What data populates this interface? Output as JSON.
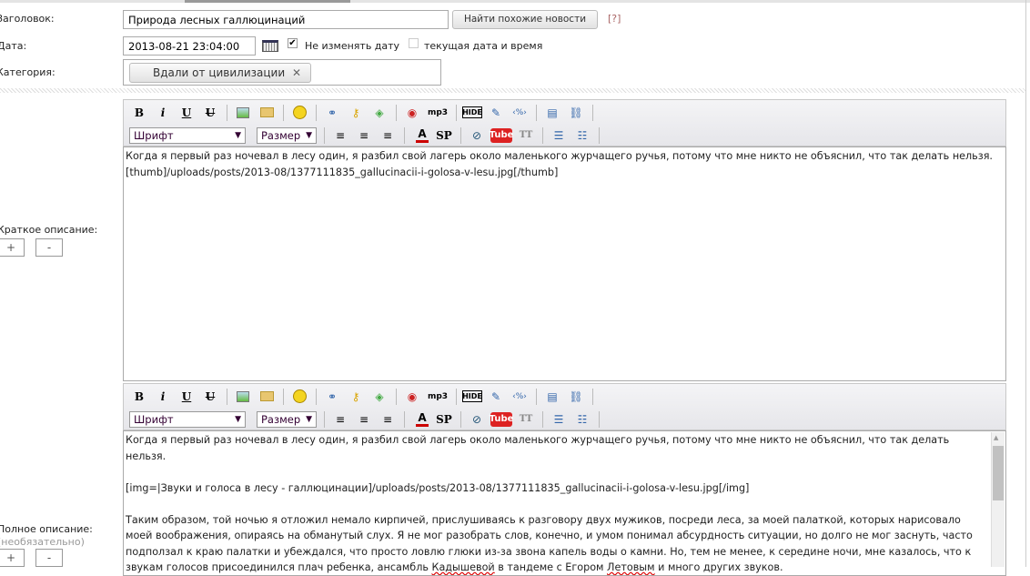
{
  "form": {
    "title_label": "Заголовок:",
    "title_value": "Природа лесных галлюцинаций",
    "find_similar_button": "Найти похожие новости",
    "help_link": "[?]",
    "date_label": "Дата:",
    "date_value": "2013-08-21 23:04:00",
    "keep_date_label": "Не изменять дату",
    "keep_date_checked": true,
    "current_date_label": "текущая дата и время",
    "current_date_checked": false,
    "category_label": "Категория:",
    "category_tag": "Вдали от цивилизации",
    "category_remove": "✕"
  },
  "toolbar": {
    "bold": "B",
    "italic": "i",
    "underline": "U",
    "strike": "U",
    "mp3": "mp3",
    "hide": "HIDE",
    "color": "A",
    "sp": "SP",
    "youtube": "Tube",
    "tt": "TT",
    "font_select": "Шрифт",
    "size_select": "Размер"
  },
  "short": {
    "label": "Краткое описание:",
    "plus": "+",
    "minus": "-",
    "text": "Когда я первый раз ночевал в лесу один, я разбил свой лагерь около маленького журчащего ручья, потому что мне никто не объяснил, что так делать нельзя.[thumb]/uploads/posts/2013-08/1377111835_gallucinacii-i-golosa-v-lesu.jpg[/thumb]"
  },
  "full": {
    "label": "Полное описание:",
    "optional": "(необязательно)",
    "plus": "+",
    "minus": "-",
    "p1": "Когда я первый раз ночевал в лесу один, я разбил свой лагерь около маленького журчащего ручья, потому что мне никто не объяснил, что так делать нельзя.",
    "p2": "[img=|Звуки и голоса в лесу - галлюцинации]/uploads/posts/2013-08/1377111835_gallucinacii-i-golosa-v-lesu.jpg[/img]",
    "p3a": "Таким образом, той ночью я отложил немало кирпичей, прислушиваясь к разговору двух мужиков, посреди леса, за моей палаткой, которых нарисовало моей воображения, опираясь на обманутый слух. Я не мог разобрать слов, конечно, и умом понимал абсурдность ситуации, но долго не мог заснуть, часто подползал к краю палатки и убеждался, что просто ловлю глюки из-за звона капель воды о камни. Но, тем не менее, к середине ночи, мне казалось, что к звукам голосов присоединился плач ребенка, ансамбль ",
    "p3b": "Кадышевой",
    "p3c": " в тандеме с Егором ",
    "p3d": "Летовым",
    "p3e": " и много других звуков."
  }
}
